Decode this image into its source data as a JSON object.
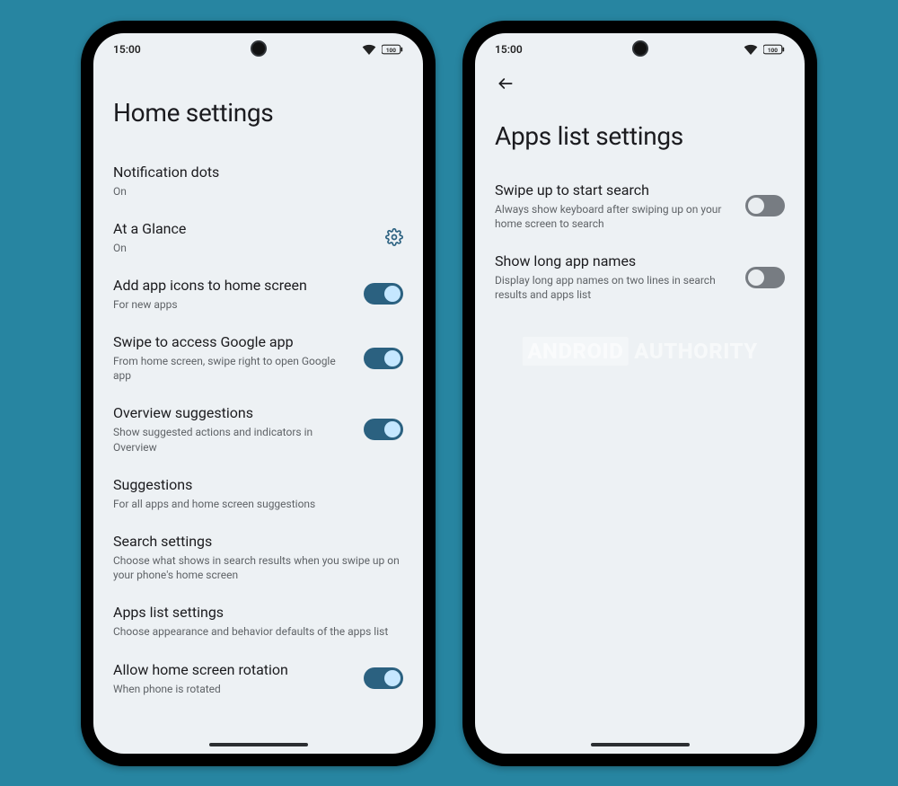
{
  "status": {
    "time": "15:00",
    "battery_label": "100"
  },
  "left": {
    "title": "Home settings",
    "items": [
      {
        "title": "Notification dots",
        "sub": "On"
      },
      {
        "title": "At a Glance",
        "sub": "On"
      },
      {
        "title": "Add app icons to home screen",
        "sub": "For new apps"
      },
      {
        "title": "Swipe to access Google app",
        "sub": "From home screen, swipe right to open Google app"
      },
      {
        "title": "Overview suggestions",
        "sub": "Show suggested actions and indicators in Overview"
      },
      {
        "title": "Suggestions",
        "sub": "For all apps and home screen suggestions"
      },
      {
        "title": "Search settings",
        "sub": "Choose what shows in search results when you swipe up on your phone's home screen"
      },
      {
        "title": "Apps list settings",
        "sub": "Choose appearance and behavior defaults of the apps list"
      },
      {
        "title": "Allow home screen rotation",
        "sub": "When phone is rotated"
      }
    ]
  },
  "right": {
    "title": "Apps list settings",
    "items": [
      {
        "title": "Swipe up to start search",
        "sub": "Always show keyboard after swiping up on your home screen to search"
      },
      {
        "title": "Show long app names",
        "sub": "Display long app names on two lines in search results and apps list"
      }
    ]
  },
  "watermark": {
    "a": "ANDROID",
    "b": "AUTHORITY"
  }
}
